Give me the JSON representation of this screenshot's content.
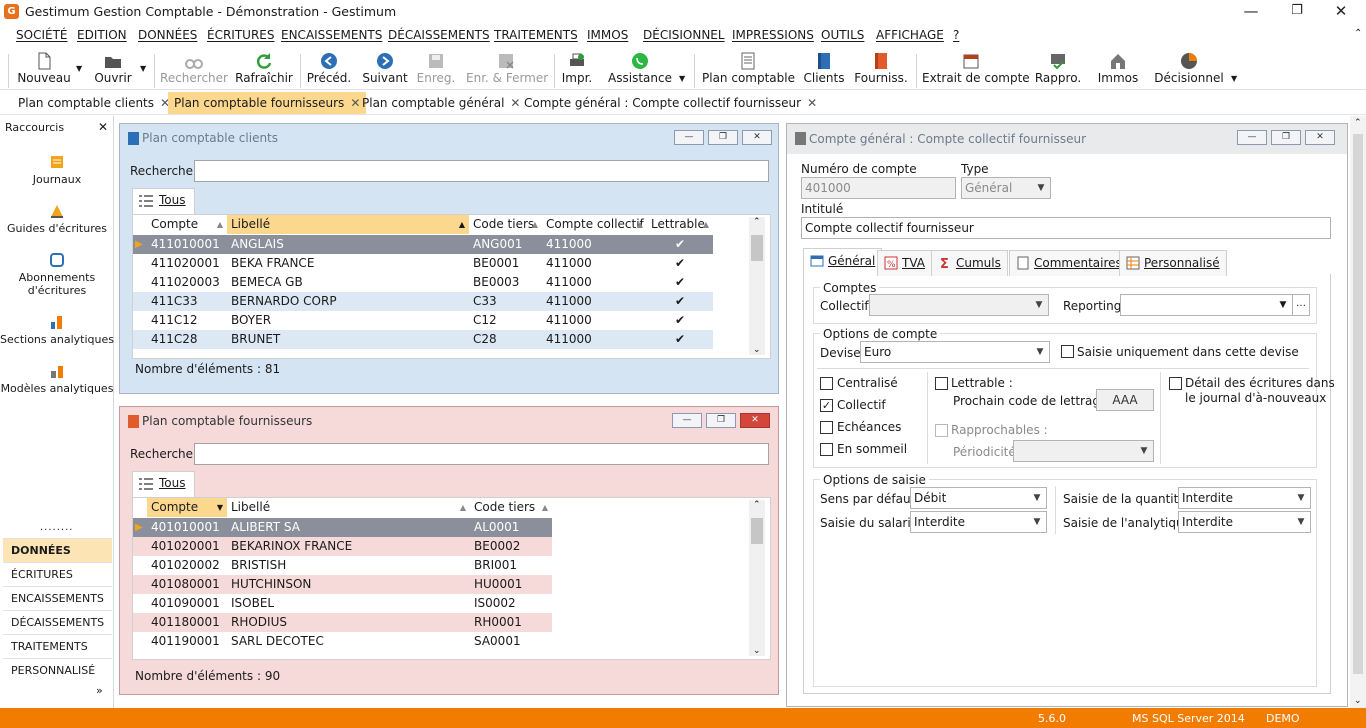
{
  "window": {
    "title": "Gestimum Gestion Comptable - Démonstration - Gestimum",
    "logo": "G"
  },
  "menu": [
    "SOCIÉTÉ",
    "EDITION",
    "DONNÉES",
    "ÉCRITURES",
    "ENCAISSEMENTS",
    "DÉCAISSEMENTS",
    "TRAITEMENTS",
    "IMMOS",
    "DÉCISIONNEL",
    "IMPRESSIONS",
    "OUTILS",
    "AFFICHAGE",
    "?"
  ],
  "toolbar": {
    "nouveau": "Nouveau",
    "ouvrir": "Ouvrir",
    "rechercher": "Rechercher",
    "rafraichir": "Rafraîchir",
    "preced": "Précéd.",
    "suivant": "Suivant",
    "enreg": "Enreg.",
    "enr_fermer": "Enr. & Fermer",
    "impr": "Impr.",
    "assistance": "Assistance",
    "plan_comptable": "Plan comptable",
    "clients": "Clients",
    "fourniss": "Fourniss.",
    "extrait": "Extrait de compte",
    "rappro": "Rappro.",
    "immos": "Immos",
    "decisionnel": "Décisionnel"
  },
  "doc_tabs": [
    "Plan comptable clients",
    "Plan comptable fournisseurs",
    "Plan comptable général",
    "Compte général : Compte collectif fournisseur"
  ],
  "sidebar": {
    "title": "Raccourcis",
    "shortcuts": [
      "Journaux",
      "Guides d'écritures",
      "Abonnements d'écritures",
      "Sections analytiques",
      "Modèles analytiques"
    ],
    "modules": [
      "DONNÉES",
      "ÉCRITURES",
      "ENCAISSEMENTS",
      "DÉCAISSEMENTS",
      "TRAITEMENTS",
      "PERSONNALISÉ"
    ]
  },
  "clients_panel": {
    "title": "Plan comptable clients",
    "search_label": "Rechercher",
    "tab": "Tous",
    "columns": [
      "Compte",
      "Libellé",
      "Code tiers",
      "Compte collectif",
      "Lettrable"
    ],
    "rows": [
      [
        "411010001",
        "ANGLAIS",
        "ANG001",
        "411000",
        "✔"
      ],
      [
        "411020001",
        "BEKA FRANCE",
        "BE0001",
        "411000",
        "✔"
      ],
      [
        "411020003",
        "BEMECA GB",
        "BE0003",
        "411000",
        "✔"
      ],
      [
        "411C33",
        "BERNARDO CORP",
        "C33",
        "411000",
        "✔"
      ],
      [
        "411C12",
        "BOYER",
        "C12",
        "411000",
        "✔"
      ],
      [
        "411C28",
        "BRUNET",
        "C28",
        "411000",
        "✔"
      ]
    ],
    "count": "Nombre d'éléments : 81"
  },
  "fourn_panel": {
    "title": "Plan comptable fournisseurs",
    "search_label": "Rechercher",
    "tab": "Tous",
    "columns": [
      "Compte",
      "Libellé",
      "Code tiers"
    ],
    "rows": [
      [
        "401010001",
        "ALIBERT SA",
        "AL0001"
      ],
      [
        "401020001",
        "BEKARINOX FRANCE",
        "BE0002"
      ],
      [
        "401020002",
        "BRISTISH",
        "BRI001"
      ],
      [
        "401080001",
        "HUTCHINSON",
        "HU0001"
      ],
      [
        "401090001",
        "ISOBEL",
        "IS0002"
      ],
      [
        "401180001",
        "RHODIUS",
        "RH0001"
      ],
      [
        "401190001",
        "SARL DECOTEC",
        "SA0001"
      ]
    ],
    "count": "Nombre d'éléments : 90"
  },
  "account_panel": {
    "title": "Compte général : Compte collectif fournisseur",
    "numero_label": "Numéro de compte",
    "numero_value": "401000",
    "type_label": "Type",
    "type_value": "Général",
    "intitule_label": "Intitulé",
    "intitule_value": "Compte collectif fournisseur",
    "tabs": [
      "Général",
      "TVA",
      "Cumuls",
      "Commentaires",
      "Personnalisé"
    ],
    "comptes_group": "Comptes",
    "collectif_label": "Collectif",
    "reporting_label": "Reporting",
    "options_group": "Options de compte",
    "devise_label": "Devise",
    "devise_value": "Euro",
    "saisie_devise": "Saisie uniquement dans cette devise",
    "centralise": "Centralisé",
    "collectif_chk": "Collectif",
    "echeances": "Echéances",
    "en_sommeil": "En sommeil",
    "lettrable": "Lettrable :",
    "prochain_label": "Prochain code de lettrage :",
    "prochain_value": "AAA",
    "rapprochables": "Rapprochables :",
    "periodicite": "Périodicité",
    "detail": "Détail des écritures dans",
    "detail2": "le journal d'à-nouveaux",
    "saisie_group": "Options de saisie",
    "sens_label": "Sens par défaut",
    "sens_value": "Débit",
    "salarie_label": "Saisie du salarié",
    "salarie_value": "Interdite",
    "quantite_label": "Saisie de la quantité",
    "quantite_value": "Interdite",
    "analytique_label": "Saisie de l'analytique",
    "analytique_value": "Interdite"
  },
  "status": {
    "version": "5.6.0",
    "server": "MS SQL Server 2014",
    "mode": "DEMO"
  },
  "colors": {
    "accent": "#f27c00",
    "selected_tab": "#fbd88d",
    "selected_row": "#8b8f9c",
    "clients_tint": "#d5e4f3",
    "fourn_tint": "#f6dada"
  }
}
